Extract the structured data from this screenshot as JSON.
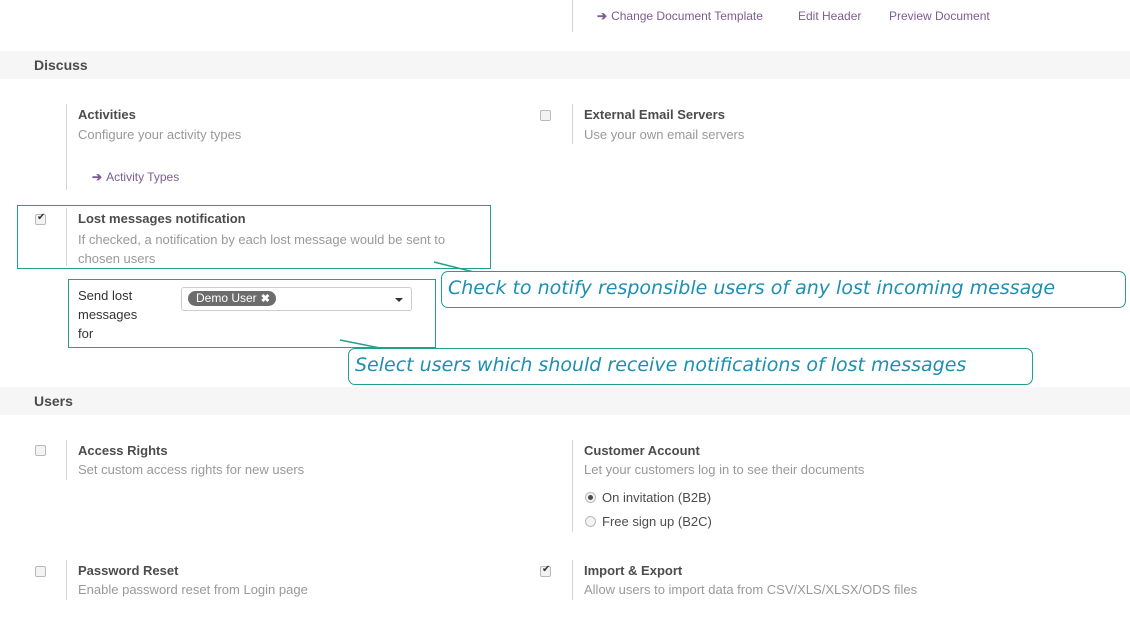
{
  "top_links": {
    "change_template": "Change Document Template",
    "edit_header": "Edit Header",
    "preview_document": "Preview Document"
  },
  "discuss": {
    "title": "Discuss",
    "activities": {
      "title": "Activities",
      "desc": "Configure your activity types",
      "link": "Activity Types"
    },
    "external_email": {
      "title": "External Email Servers",
      "desc": "Use your own email servers",
      "checked": false
    },
    "lost_messages": {
      "title": "Lost messages notification",
      "desc_line1": "If checked, a notification by each lost message would be sent to",
      "desc_line2": "chosen users",
      "checked": true,
      "field_label_1": "Send lost",
      "field_label_2": "messages",
      "field_label_3": "for",
      "selected_user": "Demo User"
    }
  },
  "callouts": {
    "notify": "Check to notify responsible users of any lost incoming message",
    "select": "Select users which should receive   notifications of lost messages"
  },
  "users": {
    "title": "Users",
    "access_rights": {
      "title": "Access Rights",
      "desc": "Set custom access rights for new users",
      "checked": false
    },
    "customer_account": {
      "title": "Customer Account",
      "desc": "Let your customers log in to see their documents",
      "option_1": "On invitation (B2B)",
      "option_2": "Free sign up (B2C)",
      "selected": "On invitation (B2B)"
    },
    "password_reset": {
      "title": "Password Reset",
      "desc": "Enable password reset from Login page",
      "checked": false
    },
    "import_export": {
      "title": "Import & Export",
      "desc": "Allow users to import data from CSV/XLS/XLSX/ODS files",
      "checked": true
    }
  },
  "colors": {
    "accent_link": "#7c5d91",
    "highlight": "#21a18b",
    "callout_text": "#1d8fb0"
  },
  "icons": {
    "link_arrow": "arrow-right-icon",
    "tag_remove": "close-icon",
    "dropdown": "caret-down-icon"
  }
}
